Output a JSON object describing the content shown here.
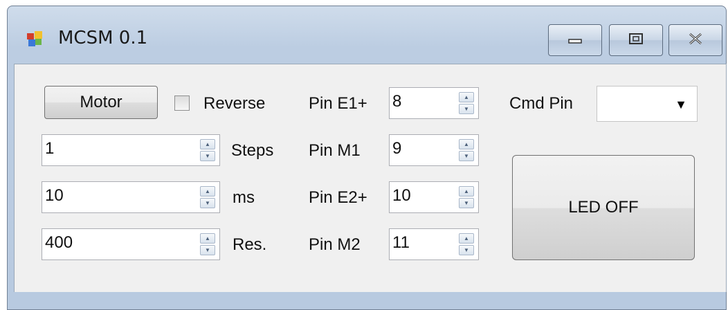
{
  "window": {
    "title": "MCSM 0.1",
    "icon": "app-window-icon",
    "caption_buttons": [
      "minimize-icon",
      "maximize-icon",
      "close-icon"
    ]
  },
  "controls": {
    "motor_label": "Motor",
    "reverse_label": "Reverse",
    "reverse_checked": false,
    "steps": {
      "value": "1",
      "unit": "Steps"
    },
    "delay": {
      "value": "10",
      "unit": "ms"
    },
    "resolution": {
      "value": "400",
      "unit": "Res."
    }
  },
  "pins": [
    {
      "label": "Pin E1+",
      "value": "8"
    },
    {
      "label": "Pin M1",
      "value": "9"
    },
    {
      "label": "Pin E2+",
      "value": "10"
    },
    {
      "label": "Pin M2",
      "value": "11"
    }
  ],
  "cmd_pin": {
    "label": "Cmd Pin",
    "selected": ""
  },
  "led_button_label": "LED OFF",
  "colors": {
    "titlebar": "#c6d5e7",
    "client": "#f0f0f0",
    "close_hover": "#c75050"
  }
}
